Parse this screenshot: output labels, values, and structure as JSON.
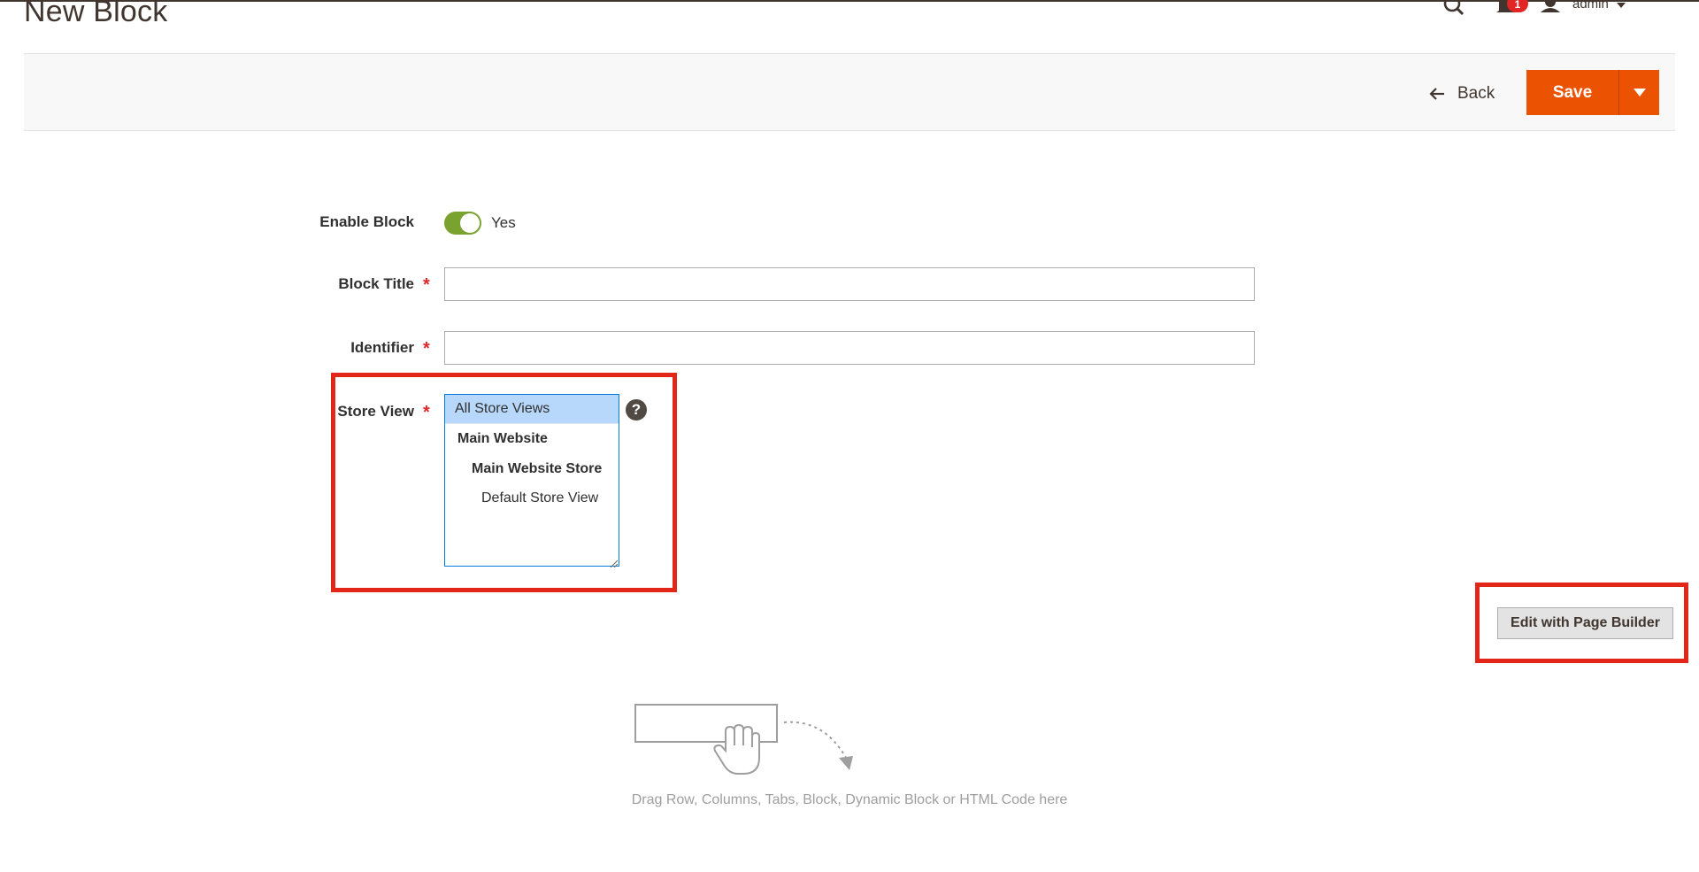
{
  "header": {
    "page_title": "New Block",
    "notification_count": "1",
    "user_name": "admin",
    "icons": [
      "search-icon",
      "bell-icon",
      "user-icon",
      "chevron-down-icon"
    ]
  },
  "action_bar": {
    "back_label": "Back",
    "save_label": "Save"
  },
  "form": {
    "enable_block": {
      "label": "Enable Block",
      "value": "Yes",
      "enabled": true
    },
    "block_title": {
      "label": "Block Title",
      "value": "",
      "required": true
    },
    "identifier": {
      "label": "Identifier",
      "value": "",
      "required": true
    },
    "store_view": {
      "label": "Store View",
      "required": true,
      "help": "?",
      "options": [
        {
          "label": "All Store Views",
          "selected": true,
          "level": 0,
          "bold": false
        },
        {
          "label": "Main Website",
          "selected": false,
          "level": 1,
          "bold": true
        },
        {
          "label": "Main Website Store",
          "selected": false,
          "level": 2,
          "bold": true
        },
        {
          "label": "Default Store View",
          "selected": false,
          "level": 3,
          "bold": false
        }
      ]
    }
  },
  "page_builder": {
    "edit_label": "Edit with Page Builder",
    "drop_hint": "Drag Row, Columns, Tabs, Block, Dynamic Block or HTML Code here"
  },
  "colors": {
    "accent": "#eb5202",
    "highlight": "#e22617",
    "toggle_on": "#79a22e",
    "selected_option": "#b7d7fb"
  }
}
